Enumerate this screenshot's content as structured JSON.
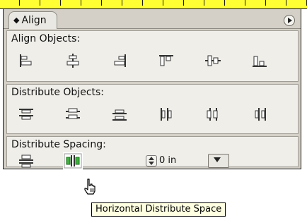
{
  "panel": {
    "tab_glyph": "◆",
    "tab_title": "Align"
  },
  "sections": {
    "align_objects": {
      "label": "Align Objects:"
    },
    "distribute_objects": {
      "label": "Distribute Objects:"
    },
    "distribute_spacing": {
      "label": "Distribute Spacing:"
    }
  },
  "spacing": {
    "value": "0 in"
  },
  "tooltip": {
    "text": "Horizontal Distribute Space"
  },
  "colors": {
    "ruler": "#ffff33",
    "panel": "#d4d0c8",
    "section": "#efeee9",
    "tooltip": "#ffffe1"
  }
}
